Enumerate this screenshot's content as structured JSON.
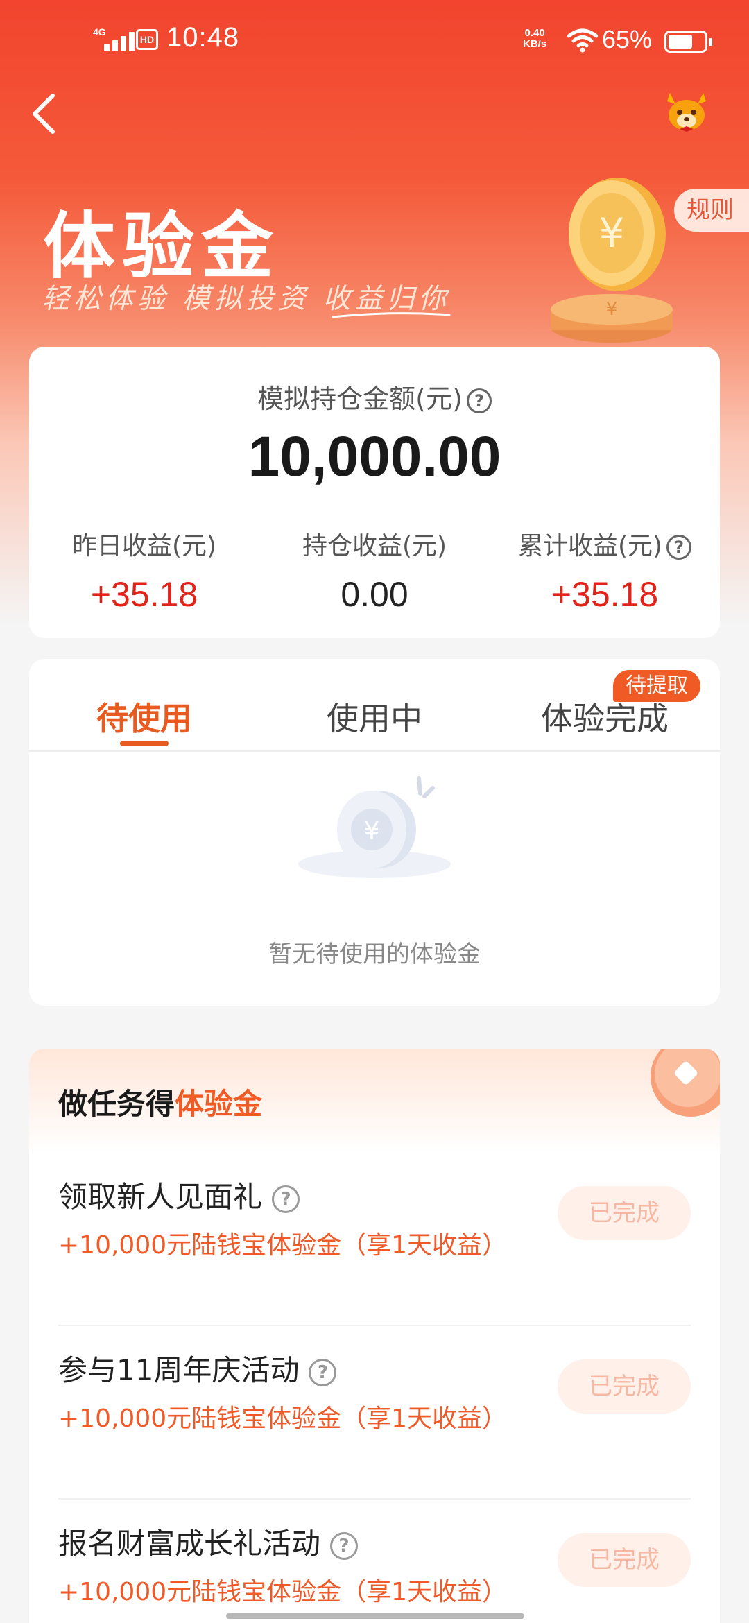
{
  "status_bar": {
    "network": "4G",
    "hd": "HD",
    "time": "10:48",
    "speed_value": "0.40",
    "speed_unit": "KB/s",
    "battery": "65%"
  },
  "hero": {
    "title": "体验金",
    "slogan": "轻松体验 模拟投资 收益归你",
    "rule_label": "规则"
  },
  "summary": {
    "label": "模拟持仓金额(元)",
    "value": "10,000.00",
    "columns": [
      {
        "label": "昨日收益(元)",
        "value": "+35.18"
      },
      {
        "label": "持仓收益(元)",
        "value": "0.00"
      },
      {
        "label": "累计收益(元)",
        "value": "+35.18"
      }
    ]
  },
  "tabs": {
    "items": [
      {
        "label": "待使用"
      },
      {
        "label": "使用中"
      },
      {
        "label": "体验完成"
      }
    ],
    "badge": "待提取",
    "empty_text": "暂无待使用的体验金"
  },
  "tasks": {
    "title_prefix": "做任务得",
    "title_highlight": "体验金",
    "items": [
      {
        "name": "领取新人见面礼",
        "reward": "+10,000元陆钱宝体验金（享1天收益）",
        "status": "已完成"
      },
      {
        "name": "参与11周年庆活动",
        "reward": "+10,000元陆钱宝体验金（享1天收益）",
        "status": "已完成"
      },
      {
        "name": "报名财富成长礼活动",
        "reward": "+10,000元陆钱宝体验金（享1天收益）",
        "status": "已完成"
      }
    ]
  },
  "colors": {
    "brand_red": "#f2442e",
    "accent_orange": "#f05a24",
    "profit_red": "#e2231a"
  }
}
